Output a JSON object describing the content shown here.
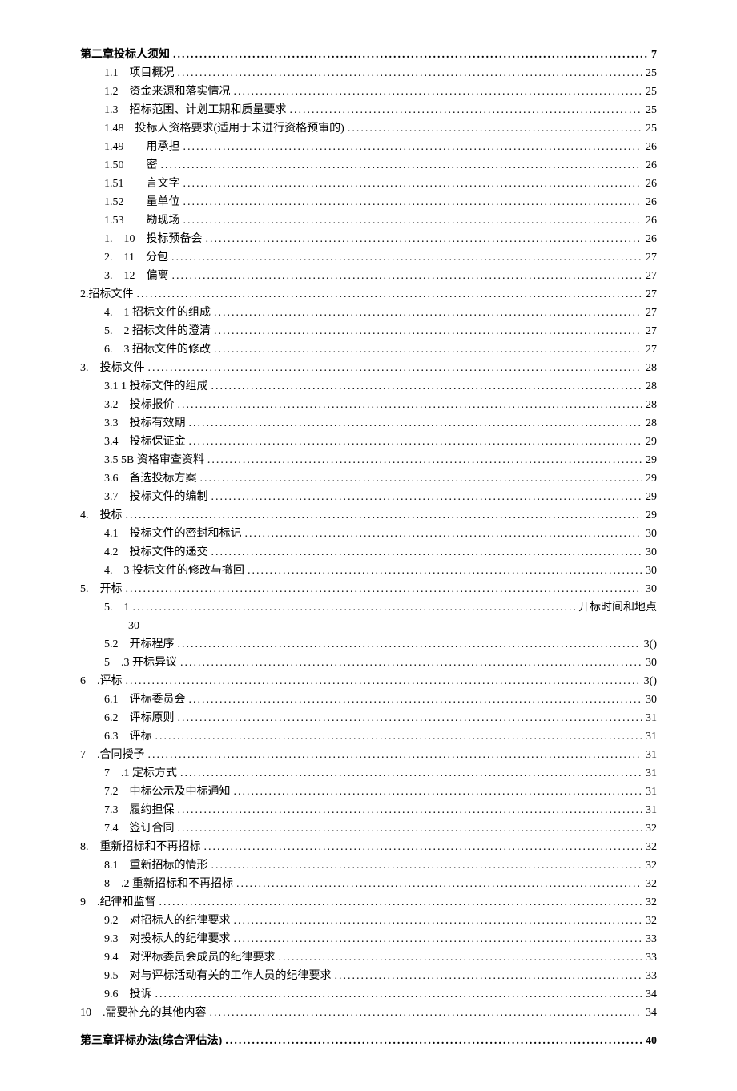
{
  "entries": [
    {
      "indent": 0,
      "chapter": true,
      "label": "第二章投标人须知",
      "page": "7",
      "wrap": false
    },
    {
      "indent": 1,
      "label": "1.1　项目概况",
      "page": "25",
      "wrap": false
    },
    {
      "indent": 1,
      "label": "1.2　资金来源和落实情况",
      "page": "25",
      "wrap": false
    },
    {
      "indent": 1,
      "label": "1.3　招标范围、计划工期和质量要求",
      "page": "25",
      "wrap": false
    },
    {
      "indent": 1,
      "label": "1.48　投标人资格要求(适用于未进行资格预审的)",
      "page": "25",
      "wrap": false
    },
    {
      "indent": 1,
      "label": "1.49　　用承担",
      "page": "26",
      "wrap": false
    },
    {
      "indent": 1,
      "label": "1.50　　密",
      "page": "26",
      "wrap": false
    },
    {
      "indent": 1,
      "label": "1.51　　言文字",
      "page": "26",
      "wrap": false
    },
    {
      "indent": 1,
      "label": "1.52　　量单位",
      "page": "26",
      "wrap": false
    },
    {
      "indent": 1,
      "label": "1.53　　勘现场",
      "page": "26",
      "wrap": false
    },
    {
      "indent": 1,
      "label": "1.　10　投标预备会",
      "page": "26",
      "wrap": false
    },
    {
      "indent": 1,
      "label": "2.　11　分包",
      "page": "27",
      "wrap": false
    },
    {
      "indent": 1,
      "label": "3.　12　偏离",
      "page": "27",
      "wrap": false
    },
    {
      "indent": 0,
      "label": "2.招标文件",
      "page": "27",
      "wrap": false
    },
    {
      "indent": 1,
      "label": "4.　1 招标文件的组成",
      "page": "27",
      "wrap": false
    },
    {
      "indent": 1,
      "label": "5.　2 招标文件的澄清",
      "page": "27",
      "wrap": false
    },
    {
      "indent": 1,
      "label": "6.　3 招标文件的修改",
      "page": "27",
      "wrap": false
    },
    {
      "indent": 0,
      "label": "3.　投标文件",
      "page": "28",
      "wrap": false
    },
    {
      "indent": 1,
      "label": "3.1 1 投标文件的组成",
      "page": "28",
      "wrap": false
    },
    {
      "indent": 1,
      "label": "3.2　投标报价",
      "page": "28",
      "wrap": false
    },
    {
      "indent": 1,
      "label": "3.3　投标有效期",
      "page": "28",
      "wrap": false
    },
    {
      "indent": 1,
      "label": "3.4　投标保证金",
      "page": "29",
      "wrap": false
    },
    {
      "indent": 1,
      "label": "3.5 5B 资格审查资料",
      "page": "29",
      "wrap": false
    },
    {
      "indent": 1,
      "label": "3.6　备选投标方案",
      "page": "29",
      "wrap": false
    },
    {
      "indent": 1,
      "label": "3.7　投标文件的编制",
      "page": "29",
      "wrap": false
    },
    {
      "indent": 0,
      "label": "4.　投标",
      "page": "29",
      "wrap": false
    },
    {
      "indent": 1,
      "label": "4.1　投标文件的密封和标记",
      "page": "30",
      "wrap": false
    },
    {
      "indent": 1,
      "label": "4.2　投标文件的递交",
      "page": "30",
      "wrap": false
    },
    {
      "indent": 1,
      "label": "4.　3 投标文件的修改与撤回",
      "page": "30",
      "wrap": false
    },
    {
      "indent": 0,
      "label": "5.　开标",
      "page": "30",
      "wrap": false
    },
    {
      "indent": 1,
      "label": "5.　1",
      "page": "开标时间和地点",
      "wrap": true,
      "wrapText": "30"
    },
    {
      "indent": 1,
      "label": "5.2　开标程序",
      "page": "3()",
      "wrap": false
    },
    {
      "indent": 1,
      "label": "5　.3 开标异议",
      "page": "30",
      "wrap": false
    },
    {
      "indent": 0,
      "label": "6　.评标",
      "page": "3()",
      "wrap": false
    },
    {
      "indent": 1,
      "label": "6.1　评标委员会",
      "page": "30",
      "wrap": false
    },
    {
      "indent": 1,
      "label": "6.2　评标原则",
      "page": "31",
      "wrap": false
    },
    {
      "indent": 1,
      "label": "6.3　评标",
      "page": "31",
      "wrap": false
    },
    {
      "indent": 0,
      "label": "7　.合同授予",
      "page": "31",
      "wrap": false
    },
    {
      "indent": 1,
      "label": "7　.1 定标方式",
      "page": "31",
      "wrap": false
    },
    {
      "indent": 1,
      "label": "7.2　中标公示及中标通知",
      "page": "31",
      "wrap": false
    },
    {
      "indent": 1,
      "label": "7.3　履约担保",
      "page": "31",
      "wrap": false
    },
    {
      "indent": 1,
      "label": "7.4　签订合同",
      "page": "32",
      "wrap": false
    },
    {
      "indent": 0,
      "label": "8.　重新招标和不再招标",
      "page": "32",
      "wrap": false
    },
    {
      "indent": 1,
      "label": "8.1　重新招标的情形",
      "page": "32",
      "wrap": false
    },
    {
      "indent": 1,
      "label": "8　.2 重新招标和不再招标",
      "page": "32",
      "wrap": false
    },
    {
      "indent": 0,
      "label": "9　.纪律和监督",
      "page": "32",
      "wrap": false
    },
    {
      "indent": 1,
      "label": "9.2　对招标人的纪律要求",
      "page": "32",
      "wrap": false
    },
    {
      "indent": 1,
      "label": "9.3　对投标人的纪律要求",
      "page": "33",
      "wrap": false
    },
    {
      "indent": 1,
      "label": "9.4　对评标委员会成员的纪律要求",
      "page": "33",
      "wrap": false
    },
    {
      "indent": 1,
      "label": "9.5　对与评标活动有关的工作人员的纪律要求",
      "page": "33",
      "wrap": false
    },
    {
      "indent": 1,
      "label": "9.6　投诉",
      "page": "34",
      "wrap": false
    },
    {
      "indent": 0,
      "label": "10　.需要补充的其他内容",
      "page": "34",
      "wrap": false
    },
    {
      "indent": 0,
      "chapter": true,
      "label": "第三章评标办法(综合评估法)",
      "page": "40",
      "wrap": false,
      "marginTop": true
    }
  ]
}
